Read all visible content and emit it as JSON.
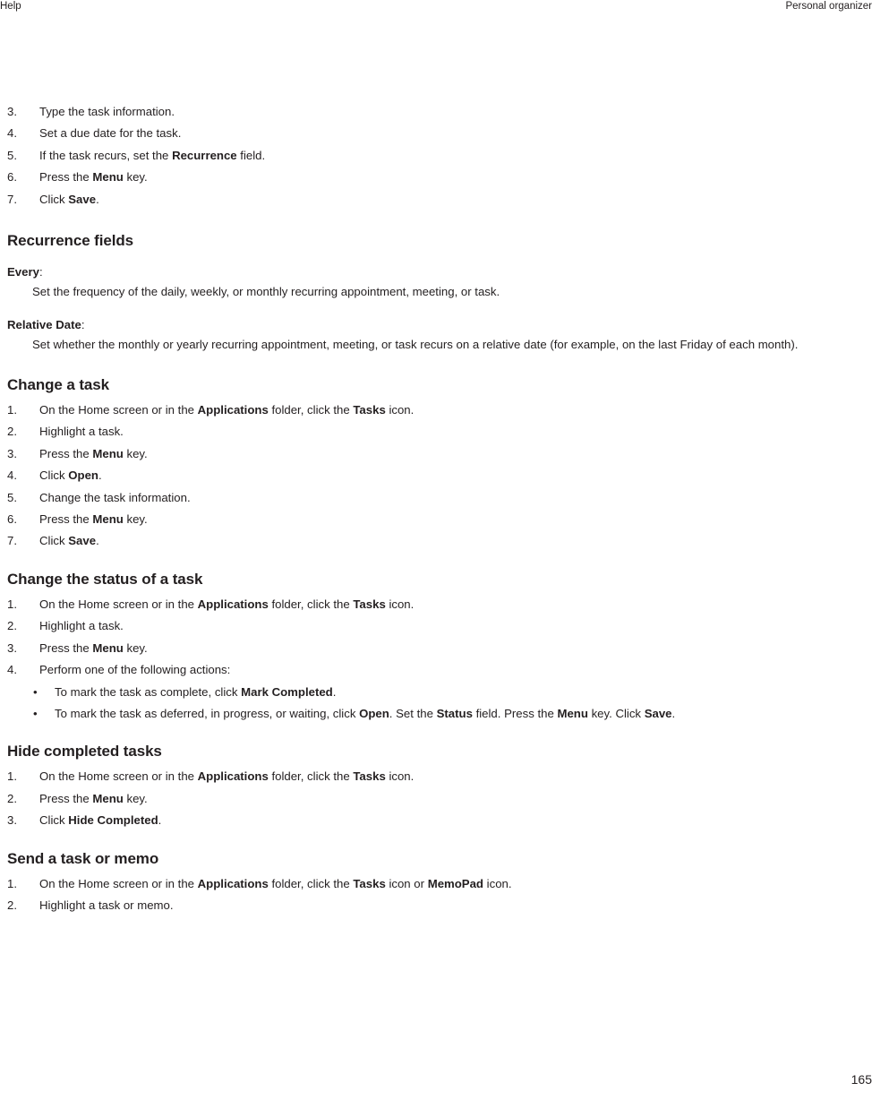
{
  "header": {
    "left": "Help",
    "right": "Personal organizer"
  },
  "footer": {
    "page_number": "165"
  },
  "intro_steps": {
    "items": [
      {
        "num": "3.",
        "parts": [
          {
            "t": "Type the task information.",
            "b": false
          }
        ]
      },
      {
        "num": "4.",
        "parts": [
          {
            "t": "Set a due date for the task.",
            "b": false
          }
        ]
      },
      {
        "num": "5.",
        "parts": [
          {
            "t": "If the task recurs, set the ",
            "b": false
          },
          {
            "t": "Recurrence",
            "b": true
          },
          {
            "t": " field.",
            "b": false
          }
        ]
      },
      {
        "num": "6.",
        "parts": [
          {
            "t": "Press the ",
            "b": false
          },
          {
            "t": "Menu",
            "b": true
          },
          {
            "t": " key.",
            "b": false
          }
        ]
      },
      {
        "num": "7.",
        "parts": [
          {
            "t": "Click ",
            "b": false
          },
          {
            "t": "Save",
            "b": true
          },
          {
            "t": ".",
            "b": false
          }
        ]
      }
    ]
  },
  "recurrence_fields": {
    "heading": "Recurrence fields",
    "definitions": [
      {
        "term": "Every",
        "term_suffix": ":",
        "description": "Set the frequency of the daily, weekly, or monthly recurring appointment, meeting, or task."
      },
      {
        "term": "Relative Date",
        "term_suffix": ":",
        "description": "Set whether the monthly or yearly recurring appointment, meeting, or task recurs on a relative date (for example, on the last Friday of each month)."
      }
    ]
  },
  "change_a_task": {
    "heading": "Change a task",
    "items": [
      {
        "num": "1.",
        "parts": [
          {
            "t": "On the Home screen or in the ",
            "b": false
          },
          {
            "t": "Applications",
            "b": true
          },
          {
            "t": " folder, click the ",
            "b": false
          },
          {
            "t": "Tasks",
            "b": true
          },
          {
            "t": " icon.",
            "b": false
          }
        ]
      },
      {
        "num": "2.",
        "parts": [
          {
            "t": "Highlight a task.",
            "b": false
          }
        ]
      },
      {
        "num": "3.",
        "parts": [
          {
            "t": "Press the ",
            "b": false
          },
          {
            "t": "Menu",
            "b": true
          },
          {
            "t": " key.",
            "b": false
          }
        ]
      },
      {
        "num": "4.",
        "parts": [
          {
            "t": "Click ",
            "b": false
          },
          {
            "t": "Open",
            "b": true
          },
          {
            "t": ".",
            "b": false
          }
        ]
      },
      {
        "num": "5.",
        "parts": [
          {
            "t": "Change the task information.",
            "b": false
          }
        ]
      },
      {
        "num": "6.",
        "parts": [
          {
            "t": "Press the ",
            "b": false
          },
          {
            "t": "Menu",
            "b": true
          },
          {
            "t": " key.",
            "b": false
          }
        ]
      },
      {
        "num": "7.",
        "parts": [
          {
            "t": "Click ",
            "b": false
          },
          {
            "t": "Save",
            "b": true
          },
          {
            "t": ".",
            "b": false
          }
        ]
      }
    ]
  },
  "change_status": {
    "heading": "Change the status of a task",
    "items": [
      {
        "num": "1.",
        "parts": [
          {
            "t": "On the Home screen or in the ",
            "b": false
          },
          {
            "t": "Applications",
            "b": true
          },
          {
            "t": " folder, click the ",
            "b": false
          },
          {
            "t": "Tasks",
            "b": true
          },
          {
            "t": " icon.",
            "b": false
          }
        ]
      },
      {
        "num": "2.",
        "parts": [
          {
            "t": "Highlight a task.",
            "b": false
          }
        ]
      },
      {
        "num": "3.",
        "parts": [
          {
            "t": "Press the ",
            "b": false
          },
          {
            "t": "Menu",
            "b": true
          },
          {
            "t": " key.",
            "b": false
          }
        ]
      },
      {
        "num": "4.",
        "parts": [
          {
            "t": "Perform one of the following actions:",
            "b": false
          }
        ]
      }
    ],
    "bullets": [
      {
        "bullet": "•",
        "parts": [
          {
            "t": "To mark the task as complete, click ",
            "b": false
          },
          {
            "t": "Mark Completed",
            "b": true
          },
          {
            "t": ".",
            "b": false
          }
        ]
      },
      {
        "bullet": "•",
        "parts": [
          {
            "t": "To mark the task as deferred, in progress, or waiting, click ",
            "b": false
          },
          {
            "t": "Open",
            "b": true
          },
          {
            "t": ". Set the ",
            "b": false
          },
          {
            "t": "Status",
            "b": true
          },
          {
            "t": " field. Press the ",
            "b": false
          },
          {
            "t": "Menu",
            "b": true
          },
          {
            "t": " key. Click ",
            "b": false
          },
          {
            "t": "Save",
            "b": true
          },
          {
            "t": ".",
            "b": false
          }
        ]
      }
    ]
  },
  "hide_completed": {
    "heading": "Hide completed tasks",
    "items": [
      {
        "num": "1.",
        "parts": [
          {
            "t": "On the Home screen or in the ",
            "b": false
          },
          {
            "t": "Applications",
            "b": true
          },
          {
            "t": " folder, click the ",
            "b": false
          },
          {
            "t": "Tasks",
            "b": true
          },
          {
            "t": " icon.",
            "b": false
          }
        ]
      },
      {
        "num": "2.",
        "parts": [
          {
            "t": "Press the ",
            "b": false
          },
          {
            "t": "Menu",
            "b": true
          },
          {
            "t": " key.",
            "b": false
          }
        ]
      },
      {
        "num": "3.",
        "parts": [
          {
            "t": "Click ",
            "b": false
          },
          {
            "t": "Hide Completed",
            "b": true
          },
          {
            "t": ".",
            "b": false
          }
        ]
      }
    ]
  },
  "send_task_or_memo": {
    "heading": "Send a task or memo",
    "items": [
      {
        "num": "1.",
        "parts": [
          {
            "t": "On the Home screen or in the ",
            "b": false
          },
          {
            "t": "Applications",
            "b": true
          },
          {
            "t": " folder, click the ",
            "b": false
          },
          {
            "t": "Tasks",
            "b": true
          },
          {
            "t": " icon or ",
            "b": false
          },
          {
            "t": "MemoPad",
            "b": true
          },
          {
            "t": " icon.",
            "b": false
          }
        ]
      },
      {
        "num": "2.",
        "parts": [
          {
            "t": "Highlight a task or memo.",
            "b": false
          }
        ]
      }
    ]
  }
}
